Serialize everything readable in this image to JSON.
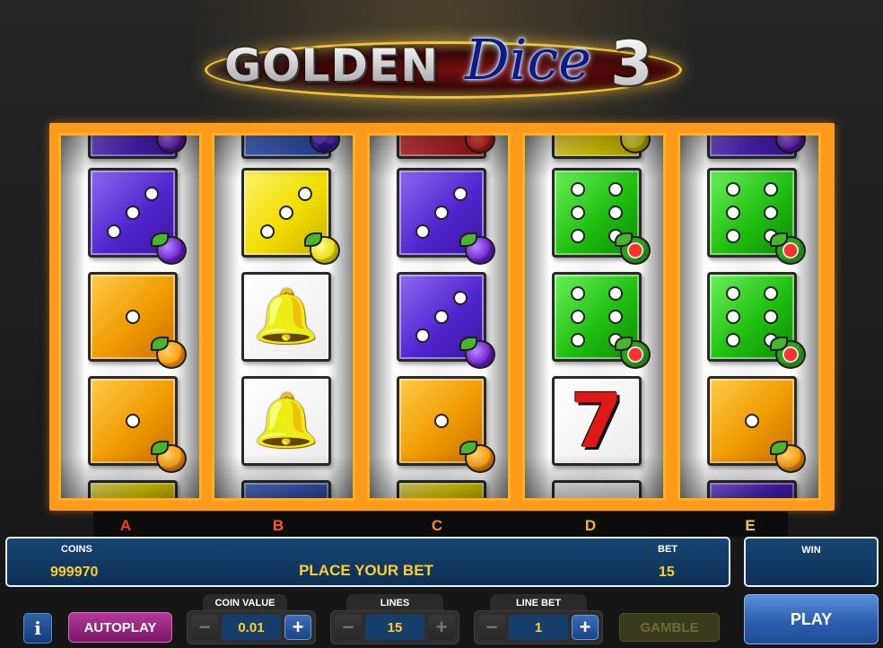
{
  "title": {
    "golden": "GOLDEN",
    "dice": "Dice",
    "number": "3"
  },
  "reel_letters": [
    "A",
    "B",
    "C",
    "D",
    "E"
  ],
  "reels": [
    {
      "id": "A",
      "top_partial": {
        "kind": "die",
        "color": "purple",
        "fruit": "plum"
      },
      "symbols": [
        {
          "kind": "die",
          "color": "purple",
          "value": 3,
          "fruit": "plum"
        },
        {
          "kind": "die",
          "color": "orange",
          "value": 1,
          "fruit": "orange"
        },
        {
          "kind": "die",
          "color": "orange",
          "value": 1,
          "fruit": "orange"
        }
      ],
      "bottom_partial": {
        "kind": "die",
        "color": "yellow"
      }
    },
    {
      "id": "B",
      "top_partial": {
        "kind": "die",
        "color": "blue",
        "fruit": "grapes"
      },
      "symbols": [
        {
          "kind": "die",
          "color": "yellow",
          "value": 3,
          "fruit": "pear"
        },
        {
          "kind": "bell"
        },
        {
          "kind": "bell"
        }
      ],
      "bottom_partial": {
        "kind": "die",
        "color": "blue"
      }
    },
    {
      "id": "C",
      "top_partial": {
        "kind": "die",
        "color": "red",
        "fruit": "strawberry"
      },
      "symbols": [
        {
          "kind": "die",
          "color": "purple",
          "value": 3,
          "fruit": "plum"
        },
        {
          "kind": "die",
          "color": "purple",
          "value": 3,
          "fruit": "plum"
        },
        {
          "kind": "die",
          "color": "orange",
          "value": 1,
          "fruit": "orange"
        }
      ],
      "bottom_partial": {
        "kind": "die",
        "color": "yellow"
      }
    },
    {
      "id": "D",
      "top_partial": {
        "kind": "die",
        "color": "yellow",
        "fruit": "pear"
      },
      "symbols": [
        {
          "kind": "die",
          "color": "green",
          "value": 6,
          "fruit": "melon"
        },
        {
          "kind": "die",
          "color": "green",
          "value": 6,
          "fruit": "melon"
        },
        {
          "kind": "seven",
          "glyph": "7"
        }
      ],
      "bottom_partial": {
        "kind": "seven"
      }
    },
    {
      "id": "E",
      "top_partial": {
        "kind": "die",
        "color": "purple",
        "fruit": "plum"
      },
      "symbols": [
        {
          "kind": "die",
          "color": "green",
          "value": 6,
          "fruit": "melon"
        },
        {
          "kind": "die",
          "color": "green",
          "value": 6,
          "fruit": "melon"
        },
        {
          "kind": "die",
          "color": "orange",
          "value": 1,
          "fruit": "orange"
        }
      ],
      "bottom_partial": {
        "kind": "die",
        "color": "purple"
      }
    }
  ],
  "info": {
    "coins_label": "COINS",
    "coins_value": "999970",
    "message": "PLACE YOUR BET",
    "bet_label": "BET",
    "bet_value": "15",
    "win_label": "WIN",
    "win_value": ""
  },
  "controls": {
    "info_label": "i",
    "autoplay_label": "AUTOPLAY",
    "coin_value_label": "COIN VALUE",
    "coin_value": "0.01",
    "lines_label": "LINES",
    "lines_value": "15",
    "line_bet_label": "LINE BET",
    "line_bet_value": "1",
    "minus_label": "−",
    "plus_label": "+",
    "gamble_label": "GAMBLE",
    "play_label": "PLAY"
  },
  "colors": {
    "reel_frame": "#ff9a1a",
    "panel_blue": "#174572",
    "value_yellow": "#ffcf2e",
    "autoplay_magenta": "#9a2682",
    "play_blue": "#2d5fb0"
  }
}
